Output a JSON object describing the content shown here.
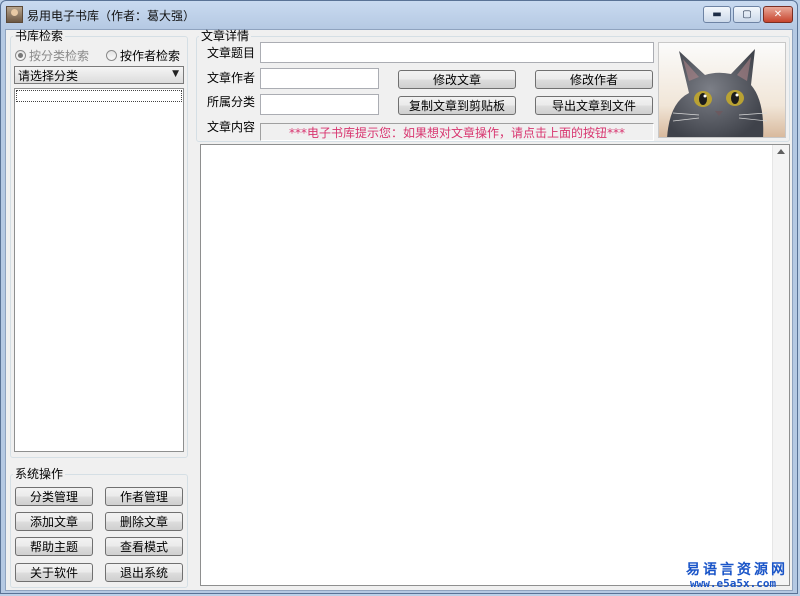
{
  "window": {
    "title": "易用电子书库（作者：葛大强）",
    "controls": {
      "minimize": "▬",
      "maximize": "▢",
      "close": "✕"
    }
  },
  "search_group": {
    "legend": "书库检索",
    "radio_category": "按分类检索",
    "radio_author": "按作者检索",
    "category_select": "请选择分类"
  },
  "system_group": {
    "legend": "系统操作",
    "buttons": [
      "分类管理",
      "作者管理",
      "添加文章",
      "删除文章",
      "帮助主题",
      "查看模式",
      "关于软件",
      "退出系统"
    ]
  },
  "detail_group": {
    "legend": "文章详情",
    "title_label": "文章题目",
    "author_label": "文章作者",
    "category_label": "所属分类",
    "content_label": "文章内容",
    "edit_article": "修改文章",
    "edit_author": "修改作者",
    "copy_clipboard": "复制文章到剪贴板",
    "export_file": "导出文章到文件",
    "hint": "***电子书库提示您：如果想对文章操作，请点击上面的按钮***"
  },
  "colors": {
    "hint": "#d8356f",
    "watermark_blue": "#1a55c8"
  },
  "watermark": {
    "line1": "易语言资源网",
    "line2": "www.e5a5x.com"
  }
}
